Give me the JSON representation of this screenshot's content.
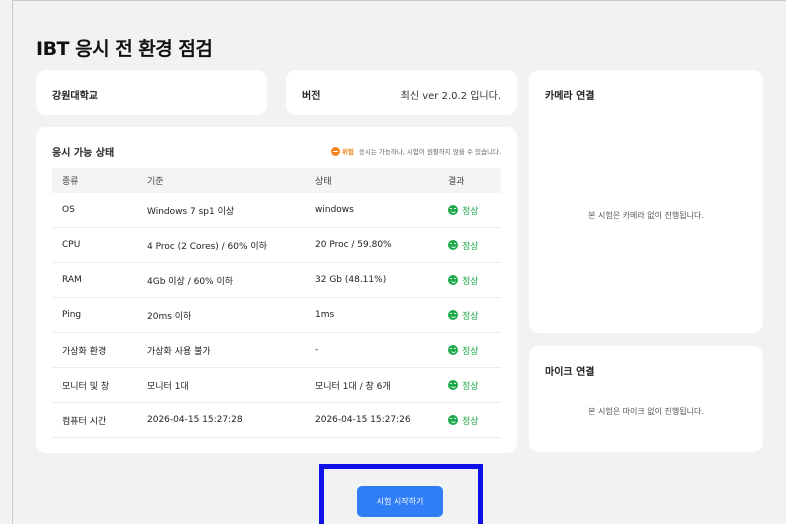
{
  "page": {
    "title": "IBT 응시 전 환경 점검"
  },
  "school": {
    "name": "강원대학교"
  },
  "version": {
    "label": "버전",
    "value": "최신 ver 2.0.2 입니다."
  },
  "status": {
    "title": "응시 가능 상태",
    "legend_word": "위험",
    "legend_text": "응시는 가능하나, 시험이 원활하지 않을 수 있습니다.",
    "warn_color": "#f5861f",
    "ok_color": "#1ea94a",
    "columns": [
      "종류",
      "기준",
      "상태",
      "결과"
    ],
    "rows": [
      {
        "type": "OS",
        "criteria": "Windows 7 sp1 이상",
        "state": "windows",
        "result": "정상"
      },
      {
        "type": "CPU",
        "criteria": "4 Proc (2 Cores) / 60% 이하",
        "state": "20 Proc / 59.80%",
        "result": "정상"
      },
      {
        "type": "RAM",
        "criteria": "4Gb 이상 / 60% 이하",
        "state": "32 Gb (48.11%)",
        "result": "정상"
      },
      {
        "type": "Ping",
        "criteria": "20ms 이하",
        "state": "1ms",
        "result": "정상"
      },
      {
        "type": "가상화 환경",
        "criteria": "가상화 사용 불가",
        "state": "-",
        "result": "정상"
      },
      {
        "type": "모니터 및 창",
        "criteria": "모니터 1대",
        "state": "모니터 1대 / 창 6개",
        "result": "정상"
      },
      {
        "type": "컴퓨터 시간",
        "criteria": "2026-04-15 15:27:28",
        "state": "2026-04-15 15:27:26",
        "result": "정상"
      }
    ]
  },
  "camera": {
    "title": "카메라 연결",
    "message": "본 시험은 카메라 없이 진행됩니다."
  },
  "mic": {
    "title": "마이크 연결",
    "message": "본 시험은 마이크 없이 진행됩니다."
  },
  "actions": {
    "start_label": "시험 시작하기",
    "accent": "#2f7ef6"
  }
}
